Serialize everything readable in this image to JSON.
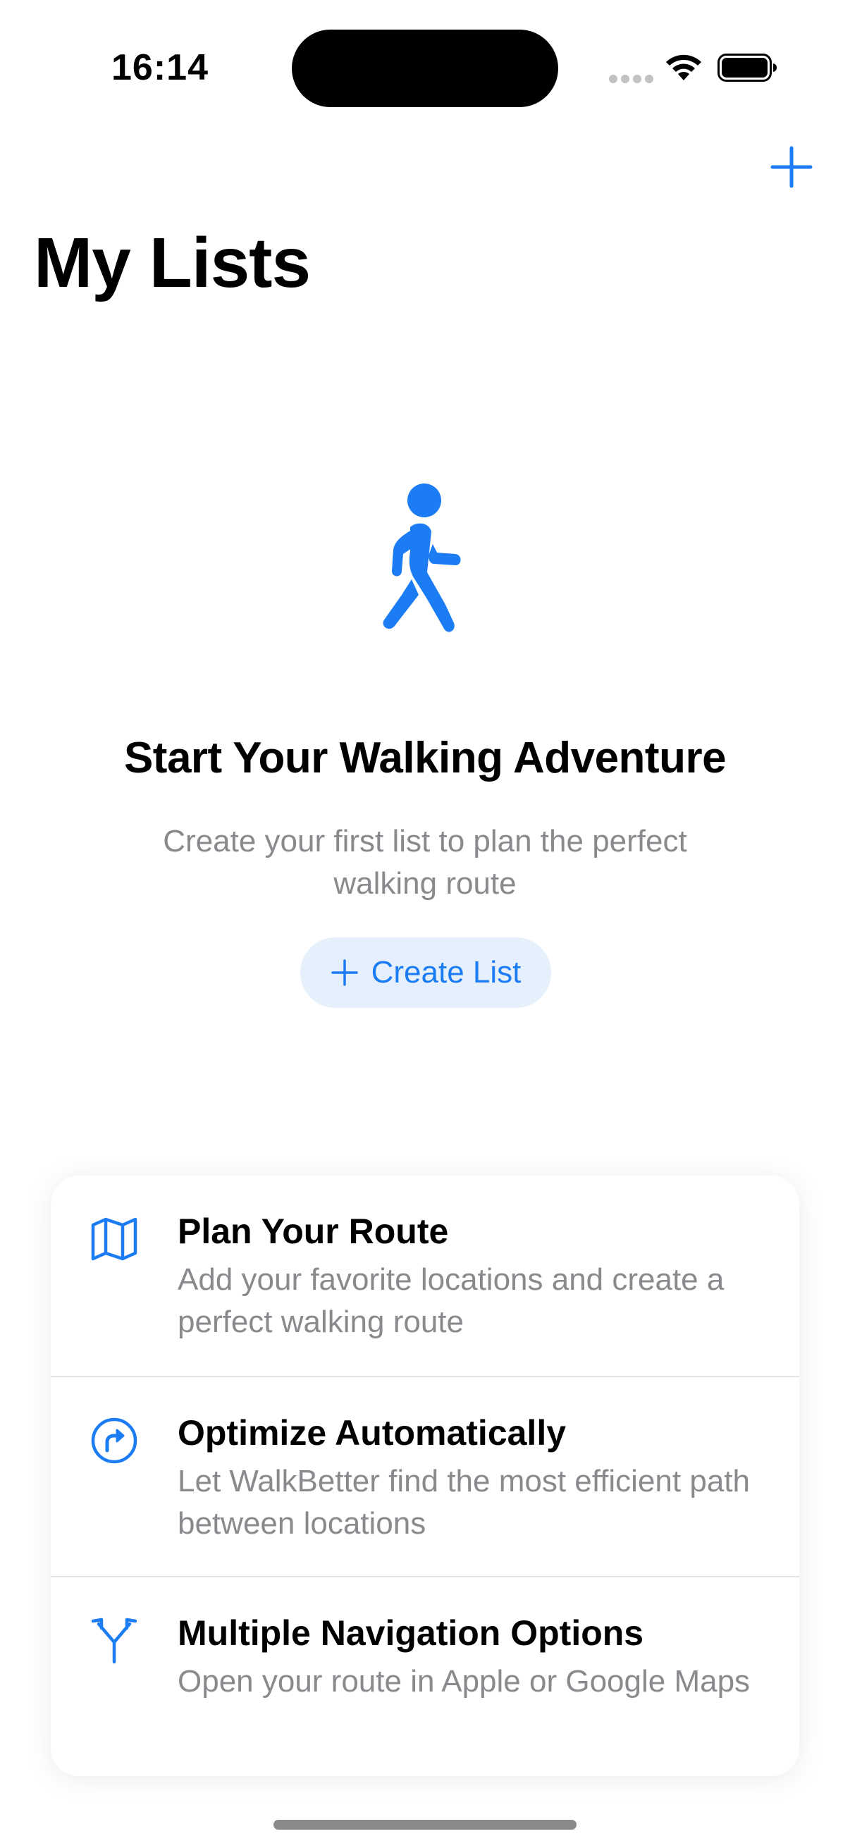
{
  "status_bar": {
    "time": "16:14"
  },
  "nav": {
    "title": "My Lists",
    "add_icon": "plus-icon"
  },
  "empty_state": {
    "icon": "figure-walk-icon",
    "title": "Start Your Walking Adventure",
    "subtitle": "Create your first list to plan the perfect walking route",
    "button_label": "Create List"
  },
  "features": [
    {
      "icon": "map-icon",
      "title": "Plan Your Route",
      "description": "Add your favorite locations and create a perfect walking route"
    },
    {
      "icon": "arrow-turn-circle-icon",
      "title": "Optimize Automatically",
      "description": "Let WalkBetter find the most efficient path between locations"
    },
    {
      "icon": "arrow-split-icon",
      "title": "Multiple Navigation Options",
      "description": "Open your route in Apple or Google Maps"
    }
  ],
  "colors": {
    "accent": "#1b7cf3",
    "secondary_text": "#8a8a8e",
    "button_background": "#e6f0fd"
  }
}
